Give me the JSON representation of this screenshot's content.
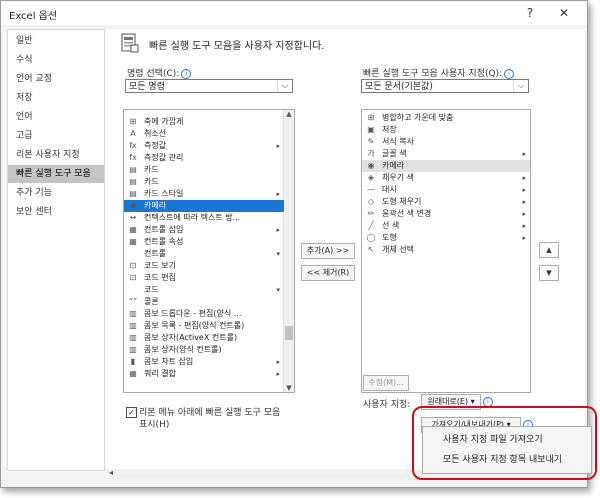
{
  "window": {
    "title": "Excel 옵션",
    "help": "?",
    "close": "✕"
  },
  "nav": [
    "일반",
    "수식",
    "언어 교정",
    "저장",
    "언어",
    "고급",
    "리본 사용자 지정",
    "빠른 실행 도구 모음",
    "추가 기능",
    "보안 센터"
  ],
  "nav_selected_index": 7,
  "header": {
    "text": "빠른 실행 도구 모음을 사용자 지정합니다."
  },
  "left": {
    "label": "명령 선택(C):",
    "combo_value": "모든 명령",
    "items": [
      {
        "icon": "·",
        "text": "",
        "arrow": ""
      },
      {
        "icon": "⊞",
        "text": "축에 가깝게",
        "arrow": ""
      },
      {
        "icon": "A",
        "text": "취소선",
        "arrow": ""
      },
      {
        "icon": "fx",
        "text": "측정값",
        "arrow": "▸"
      },
      {
        "icon": "fx",
        "text": "측정값 관리",
        "arrow": ""
      },
      {
        "icon": "▤",
        "text": "카드",
        "arrow": ""
      },
      {
        "icon": "▤",
        "text": "카드",
        "arrow": ""
      },
      {
        "icon": "▤",
        "text": "카드 스타일",
        "arrow": "▸"
      },
      {
        "icon": "◉",
        "text": "카메라",
        "arrow": ""
      },
      {
        "icon": "↔",
        "text": "컨텍스트에 따라 텍스트 방...",
        "arrow": ""
      },
      {
        "icon": "▦",
        "text": "컨트롤 삽입",
        "arrow": "▸"
      },
      {
        "icon": "▦",
        "text": "컨트롤 속성",
        "arrow": ""
      },
      {
        "icon": "",
        "text": "컨트롤",
        "arrow": "▾"
      },
      {
        "icon": "⊡",
        "text": "코드 보기",
        "arrow": ""
      },
      {
        "icon": "⊡",
        "text": "코드 편집",
        "arrow": ""
      },
      {
        "icon": "",
        "text": "코드",
        "arrow": "▾"
      },
      {
        "icon": "“”",
        "text": "콜론",
        "arrow": ""
      },
      {
        "icon": "▥",
        "text": "콤보 드롭다운 - 편집(양식 ...",
        "arrow": ""
      },
      {
        "icon": "▥",
        "text": "콤보 목록 - 편집(양식 컨트롤)",
        "arrow": ""
      },
      {
        "icon": "▥",
        "text": "콤보 상자(ActiveX 컨트롤)",
        "arrow": ""
      },
      {
        "icon": "▥",
        "text": "콤보 상자(양식 컨트롤)",
        "arrow": ""
      },
      {
        "icon": "▮",
        "text": "콤보 차트 삽입",
        "arrow": "▸"
      },
      {
        "icon": "▦",
        "text": "쿼리 결합",
        "arrow": "▸"
      }
    ],
    "selected_index": 8,
    "checkbox_label_1": "리본 메뉴 아래에 빠른 실행 도구 모음",
    "checkbox_label_2": "표시(H)",
    "checkbox_checked": "✓"
  },
  "middle": {
    "add": "추가(A) >>",
    "remove": "<< 제거(R)"
  },
  "right": {
    "label": "빠른 실행 도구 모음 사용자 지정(Q):",
    "combo_value": "모든 문서(기본값)",
    "items": [
      {
        "icon": "⊞",
        "text": "병합하고 가운데 맞춤",
        "arrow": ""
      },
      {
        "icon": "▣",
        "text": "저장",
        "arrow": ""
      },
      {
        "icon": "✎",
        "text": "서식 복사",
        "arrow": ""
      },
      {
        "icon": "가",
        "text": "글꼴 색",
        "arrow": "▸"
      },
      {
        "icon": "◉",
        "text": "카메라",
        "arrow": ""
      },
      {
        "icon": "◈",
        "text": "채우기 색",
        "arrow": "▸"
      },
      {
        "icon": "—",
        "text": "대시",
        "arrow": "▸"
      },
      {
        "icon": "◇",
        "text": "도형 채우기",
        "arrow": "▸"
      },
      {
        "icon": "✏",
        "text": "윤곽선 색 변경",
        "arrow": "▸"
      },
      {
        "icon": "╱",
        "text": "선 색",
        "arrow": "▸"
      },
      {
        "icon": "◯",
        "text": "도형",
        "arrow": "▸"
      },
      {
        "icon": "↖",
        "text": "개체 선택",
        "arrow": ""
      }
    ],
    "highlight_index": 4,
    "modify": "수정(M)...",
    "custom_label": "사용자 지정:",
    "reset": "원래대로(E) ▾",
    "import_export": "가져오기/내보내기(P) ▾",
    "move_up": "▲",
    "move_down": "▼"
  },
  "menu": {
    "items": [
      "사용자 지정 파일 가져오기",
      "모든 사용자 지정 항목 내보내기"
    ]
  },
  "colors": {
    "selection": "#1976d2",
    "nav_selected": "#c5c5c5",
    "callout": "#cc1111"
  }
}
